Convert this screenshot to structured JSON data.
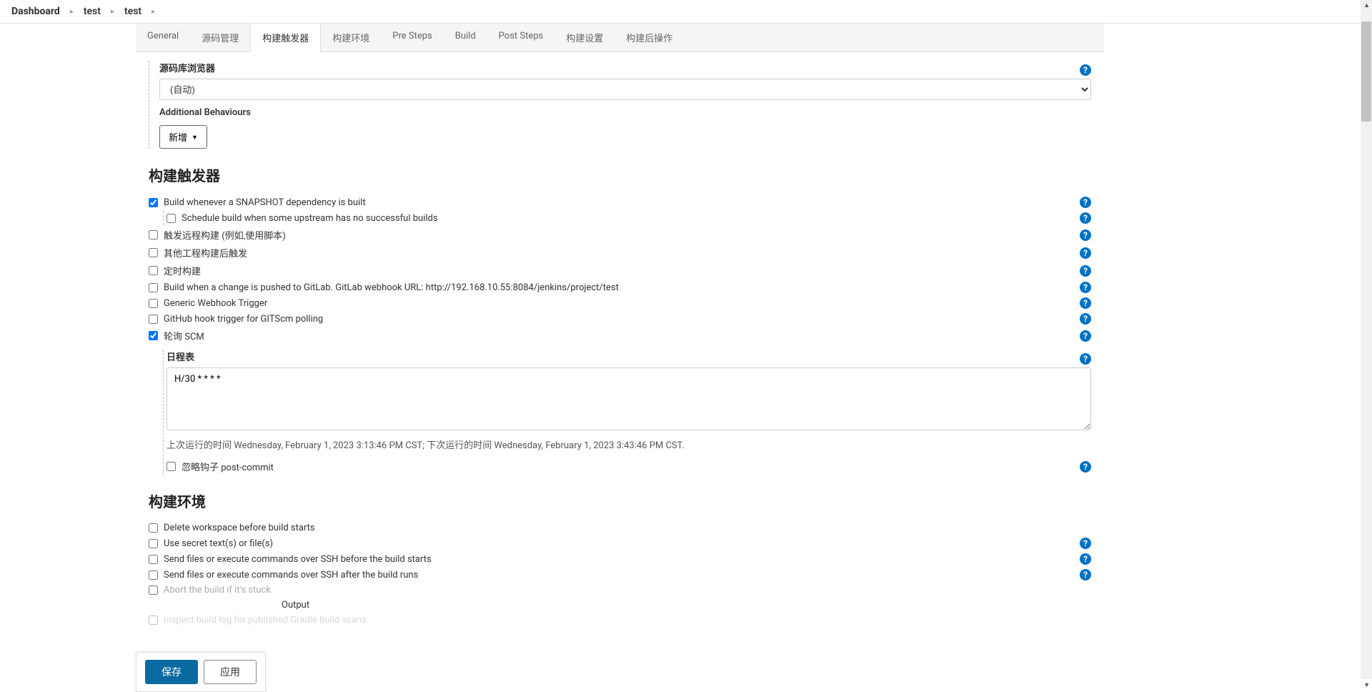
{
  "breadcrumbs": [
    "Dashboard",
    "test",
    "test"
  ],
  "tabs": [
    "General",
    "源码管理",
    "构建触发器",
    "构建环境",
    "Pre Steps",
    "Build",
    "Post Steps",
    "构建设置",
    "构建后操作"
  ],
  "active_tab_index": 2,
  "scm": {
    "browser_label": "源码库浏览器",
    "browser_selected": "(自动)",
    "additional_label": "Additional Behaviours",
    "add_new_label": "新增"
  },
  "triggers": {
    "title": "构建触发器",
    "items": [
      {
        "label": "Build whenever a SNAPSHOT dependency is built",
        "checked": true,
        "help": true
      },
      {
        "label": "Schedule build when some upstream has no successful builds",
        "checked": false,
        "help": true,
        "indented": true
      },
      {
        "label": "触发远程构建 (例如,使用脚本)",
        "checked": false,
        "help": true
      },
      {
        "label": "其他工程构建后触发",
        "checked": false,
        "help": true
      },
      {
        "label": "定时构建",
        "checked": false,
        "help": true
      },
      {
        "label": "Build when a change is pushed to GitLab. GitLab webhook URL: http://192.168.10.55:8084/jenkins/project/test",
        "checked": false,
        "help": true
      },
      {
        "label": "Generic Webhook Trigger",
        "checked": false,
        "help": true
      },
      {
        "label": "GitHub hook trigger for GITScm polling",
        "checked": false,
        "help": true
      },
      {
        "label": "轮询 SCM",
        "checked": true,
        "help": true
      }
    ],
    "schedule_label": "日程表",
    "schedule_value": "H/30 * * * *",
    "schedule_hint": "上次运行的时间 Wednesday, February 1, 2023 3:13:46 PM CST; 下次运行的时间 Wednesday, February 1, 2023 3:43:46 PM CST.",
    "ignore_post_commit": {
      "label": "忽略钩子 post-commit",
      "checked": false
    }
  },
  "env": {
    "title": "构建环境",
    "items": [
      {
        "label": "Delete workspace before build starts",
        "checked": false,
        "help": false
      },
      {
        "label": "Use secret text(s) or file(s)",
        "checked": false,
        "help": true
      },
      {
        "label": "Send files or execute commands over SSH before the build starts",
        "checked": false,
        "help": true
      },
      {
        "label": "Send files or execute commands over SSH after the build runs",
        "checked": false,
        "help": true
      },
      {
        "label": "Abort the build if it's stuck",
        "checked": false,
        "help": false,
        "dimmed": true
      },
      {
        "label": "Output",
        "checked": false,
        "help": false,
        "dimmed": true,
        "partial": true
      }
    ],
    "hidden_partial": "Inspect build log for published Gradle build scans"
  },
  "footer": {
    "save": "保存",
    "apply": "应用"
  }
}
